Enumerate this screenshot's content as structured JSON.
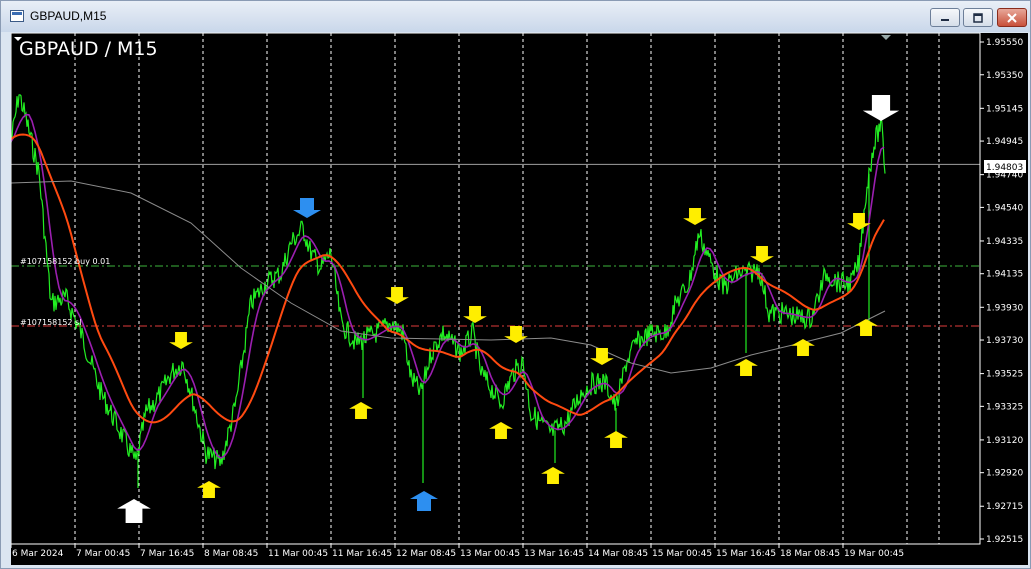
{
  "window": {
    "title": "GBPAUD,M15"
  },
  "chart": {
    "symbol_label": "GBPAUD / M15",
    "price_labels": [
      "1.95550",
      "1.95350",
      "1.95145",
      "1.94945",
      "1.94740",
      "1.94540",
      "1.94335",
      "1.94135",
      "1.93930",
      "1.93730",
      "1.93525",
      "1.93325",
      "1.93120",
      "1.92920",
      "1.92715",
      "1.92515"
    ],
    "time_labels": [
      "6 Mar 2024",
      "7 Mar 00:45",
      "7 Mar 16:45",
      "8 Mar 08:45",
      "11 Mar 00:45",
      "11 Mar 16:45",
      "12 Mar 08:45",
      "13 Mar 00:45",
      "13 Mar 16:45",
      "14 Mar 08:45",
      "15 Mar 00:45",
      "15 Mar 16:45",
      "18 Mar 08:45",
      "19 Mar 00:45"
    ],
    "current_price": "1.94803",
    "order_labels": [
      "#107158152 buy 0.01",
      "#107158152 sl"
    ],
    "price_min": 1.92515,
    "price_max": 1.9555,
    "colors": {
      "background": "#000000",
      "price_line": "#22ee22",
      "fast_ma": "#9b1fb0",
      "slow_ma": "#ff4a10",
      "long_ma": "#8c8c8c",
      "buy_line": "#3cb43c",
      "sl_line": "#e03c3c",
      "arrow_yellow": "#ffee00",
      "arrow_blue": "#2d8ff0",
      "arrow_white": "#ffffff"
    }
  }
}
